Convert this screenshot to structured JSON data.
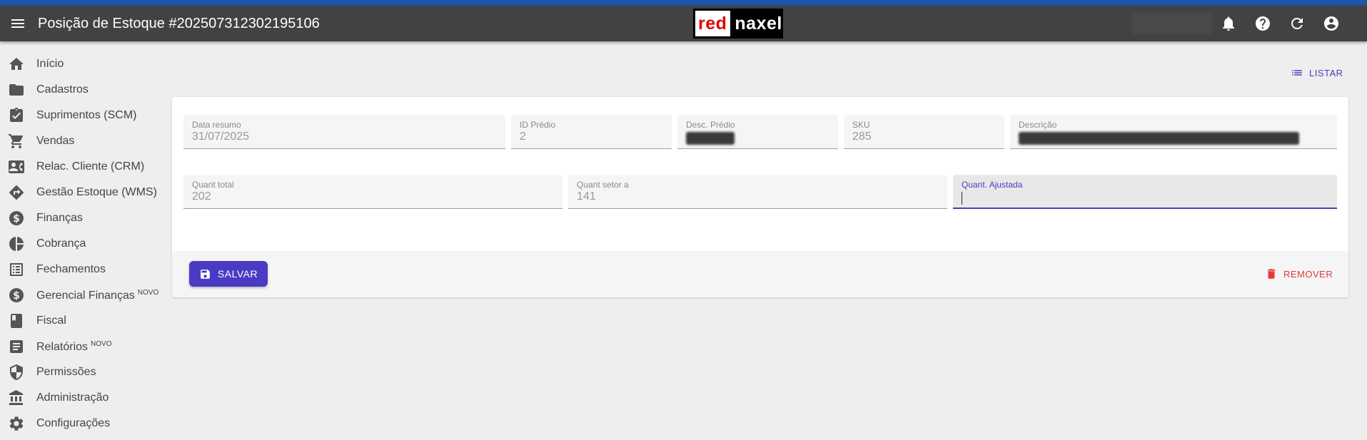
{
  "appbar": {
    "title": "Posição de Estoque #202507312302195106",
    "logo_part1": "red",
    "logo_part2": "naxel",
    "icons": [
      "menu-icon",
      "bell-icon",
      "help-icon",
      "refresh-icon",
      "account-icon"
    ]
  },
  "sidebar": {
    "items": [
      {
        "label": "Início",
        "icon": "home-icon",
        "badge": ""
      },
      {
        "label": "Cadastros",
        "icon": "folder-icon",
        "badge": ""
      },
      {
        "label": "Suprimentos (SCM)",
        "icon": "clipboard-icon",
        "badge": ""
      },
      {
        "label": "Vendas",
        "icon": "cart-icon",
        "badge": ""
      },
      {
        "label": "Relac. Cliente (CRM)",
        "icon": "contact-card-icon",
        "badge": ""
      },
      {
        "label": "Gestão Estoque (WMS)",
        "icon": "directions-icon",
        "badge": ""
      },
      {
        "label": "Finanças",
        "icon": "dollar-icon",
        "badge": ""
      },
      {
        "label": "Cobrança",
        "icon": "pie-chart-icon",
        "badge": ""
      },
      {
        "label": "Fechamentos",
        "icon": "list-alt-icon",
        "badge": ""
      },
      {
        "label": "Gerencial Finanças",
        "icon": "dollar-icon",
        "badge": "NOVO"
      },
      {
        "label": "Fiscal",
        "icon": "book-icon",
        "badge": ""
      },
      {
        "label": "Relatórios",
        "icon": "report-icon",
        "badge": "NOVO"
      },
      {
        "label": "Permissões",
        "icon": "shield-icon",
        "badge": ""
      },
      {
        "label": "Administração",
        "icon": "bank-icon",
        "badge": ""
      },
      {
        "label": "Configurações",
        "icon": "gear-icon",
        "badge": ""
      }
    ]
  },
  "toolbar": {
    "list_label": "LISTAR"
  },
  "form": {
    "data_resumo": {
      "label": "Data resumo",
      "value": "31/07/2025"
    },
    "id_predio": {
      "label": "ID Prédio",
      "value": "2"
    },
    "desc_predio": {
      "label": "Desc. Prédio",
      "value": ""
    },
    "sku": {
      "label": "SKU",
      "value": "285"
    },
    "descricao": {
      "label": "Descrição",
      "value": ""
    },
    "quant_total": {
      "label": "Quant total",
      "value": "202"
    },
    "quant_setor": {
      "label": "Quant setor a",
      "value": "141"
    },
    "quant_ajustada": {
      "label": "Quant. Ajustada",
      "value": ""
    }
  },
  "actions": {
    "save_label": "SALVAR",
    "remove_label": "REMOVER"
  },
  "colors": {
    "primary": "#4a3bc4",
    "appbar": "#424242",
    "accent_top": "#1e55a8",
    "danger": "#e53935"
  }
}
